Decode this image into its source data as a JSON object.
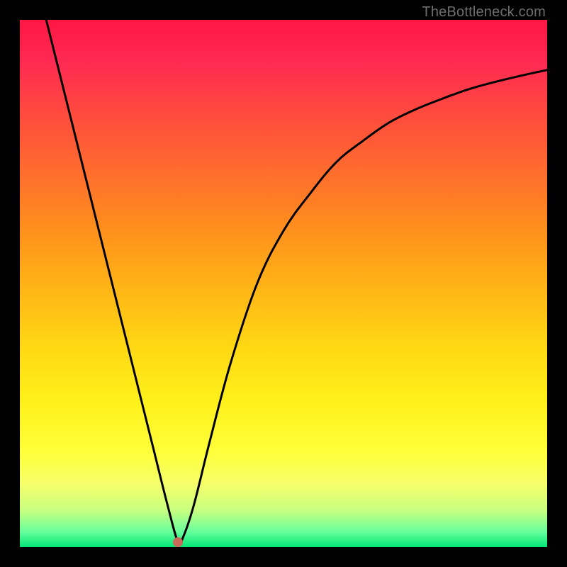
{
  "watermark": "TheBottleneck.com",
  "colors": {
    "frame": "#000000",
    "curve": "#000000",
    "dot": "#c96a5a",
    "gradient_top": "#ff1744",
    "gradient_bottom": "#00e676"
  },
  "chart_data": {
    "type": "line",
    "title": "",
    "xlabel": "",
    "ylabel": "",
    "xlim": [
      0,
      100
    ],
    "ylim": [
      0,
      100
    ],
    "grid": false,
    "legend": false,
    "annotations": [
      {
        "type": "marker",
        "x": 30,
        "y": 1,
        "label": "optimal-point"
      }
    ],
    "series": [
      {
        "name": "bottleneck-curve",
        "x": [
          5,
          10,
          15,
          20,
          25,
          28,
          30,
          31,
          33,
          36,
          40,
          45,
          50,
          55,
          60,
          65,
          70,
          75,
          80,
          85,
          90,
          95,
          100
        ],
        "values": [
          100,
          80,
          60,
          40,
          20,
          8,
          1,
          2,
          8,
          20,
          35,
          50,
          60,
          67,
          73,
          77,
          80.5,
          83,
          85,
          86.8,
          88.2,
          89.4,
          90.5
        ]
      }
    ]
  }
}
